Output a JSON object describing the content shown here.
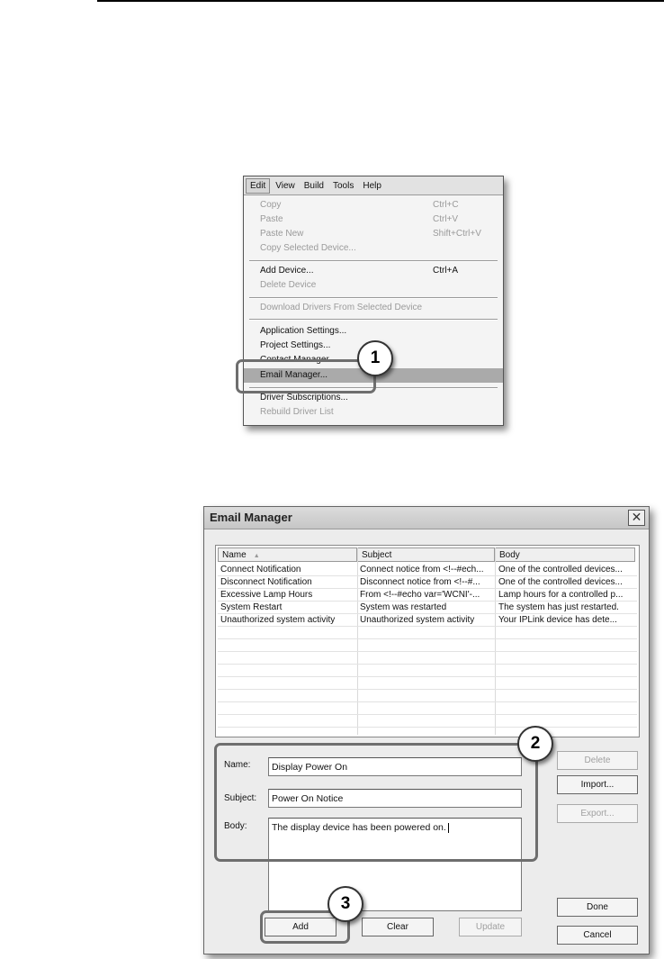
{
  "menu": {
    "bar": [
      "Edit",
      "View",
      "Build",
      "Tools",
      "Help"
    ],
    "items": [
      {
        "label": "Copy",
        "shortcut": "Ctrl+C"
      },
      {
        "label": "Paste",
        "shortcut": "Ctrl+V"
      },
      {
        "label": "Paste New",
        "shortcut": "Shift+Ctrl+V"
      },
      {
        "label": "Copy Selected Device...",
        "shortcut": ""
      },
      {
        "label": "Add Device...",
        "shortcut": "Ctrl+A"
      },
      {
        "label": "Delete Device",
        "shortcut": ""
      },
      {
        "label": "Download Drivers From Selected Device",
        "shortcut": ""
      },
      {
        "label": "Application Settings...",
        "shortcut": ""
      },
      {
        "label": "Project Settings...",
        "shortcut": ""
      },
      {
        "label": "Contact Manager...",
        "shortcut": ""
      },
      {
        "label": "Email Manager...",
        "shortcut": ""
      },
      {
        "label": "Driver Subscriptions...",
        "shortcut": ""
      },
      {
        "label": "Rebuild Driver List",
        "shortcut": ""
      }
    ]
  },
  "callouts": [
    "1",
    "2",
    "3"
  ],
  "dialog": {
    "title": "Email Manager",
    "close_icon": "close-icon",
    "columns": [
      "Name",
      "Subject",
      "Body"
    ],
    "sort_indicator": "▲",
    "rows": [
      [
        "Connect Notification",
        "Connect notice from <!--#ech...",
        "One of the controlled devices..."
      ],
      [
        "Disconnect Notification",
        "Disconnect notice from <!--#...",
        "One of the controlled devices..."
      ],
      [
        "Excessive Lamp Hours",
        "From <!--#echo var='WCNI'-...",
        "Lamp hours for a controlled p..."
      ],
      [
        "System Restart",
        "System was restarted",
        "The system has just restarted."
      ],
      [
        "Unauthorized system activity",
        "Unauthorized system activity",
        "Your IPLink device has dete..."
      ]
    ],
    "form": {
      "name_label": "Name:",
      "name_value": "Display Power On",
      "subject_label": "Subject:",
      "subject_value": "Power On Notice",
      "body_label": "Body:",
      "body_value": "The display device has been powered on."
    },
    "buttons": {
      "delete": "Delete",
      "import": "Import...",
      "export": "Export...",
      "done": "Done",
      "cancel": "Cancel",
      "add": "Add",
      "clear": "Clear",
      "update": "Update"
    }
  }
}
